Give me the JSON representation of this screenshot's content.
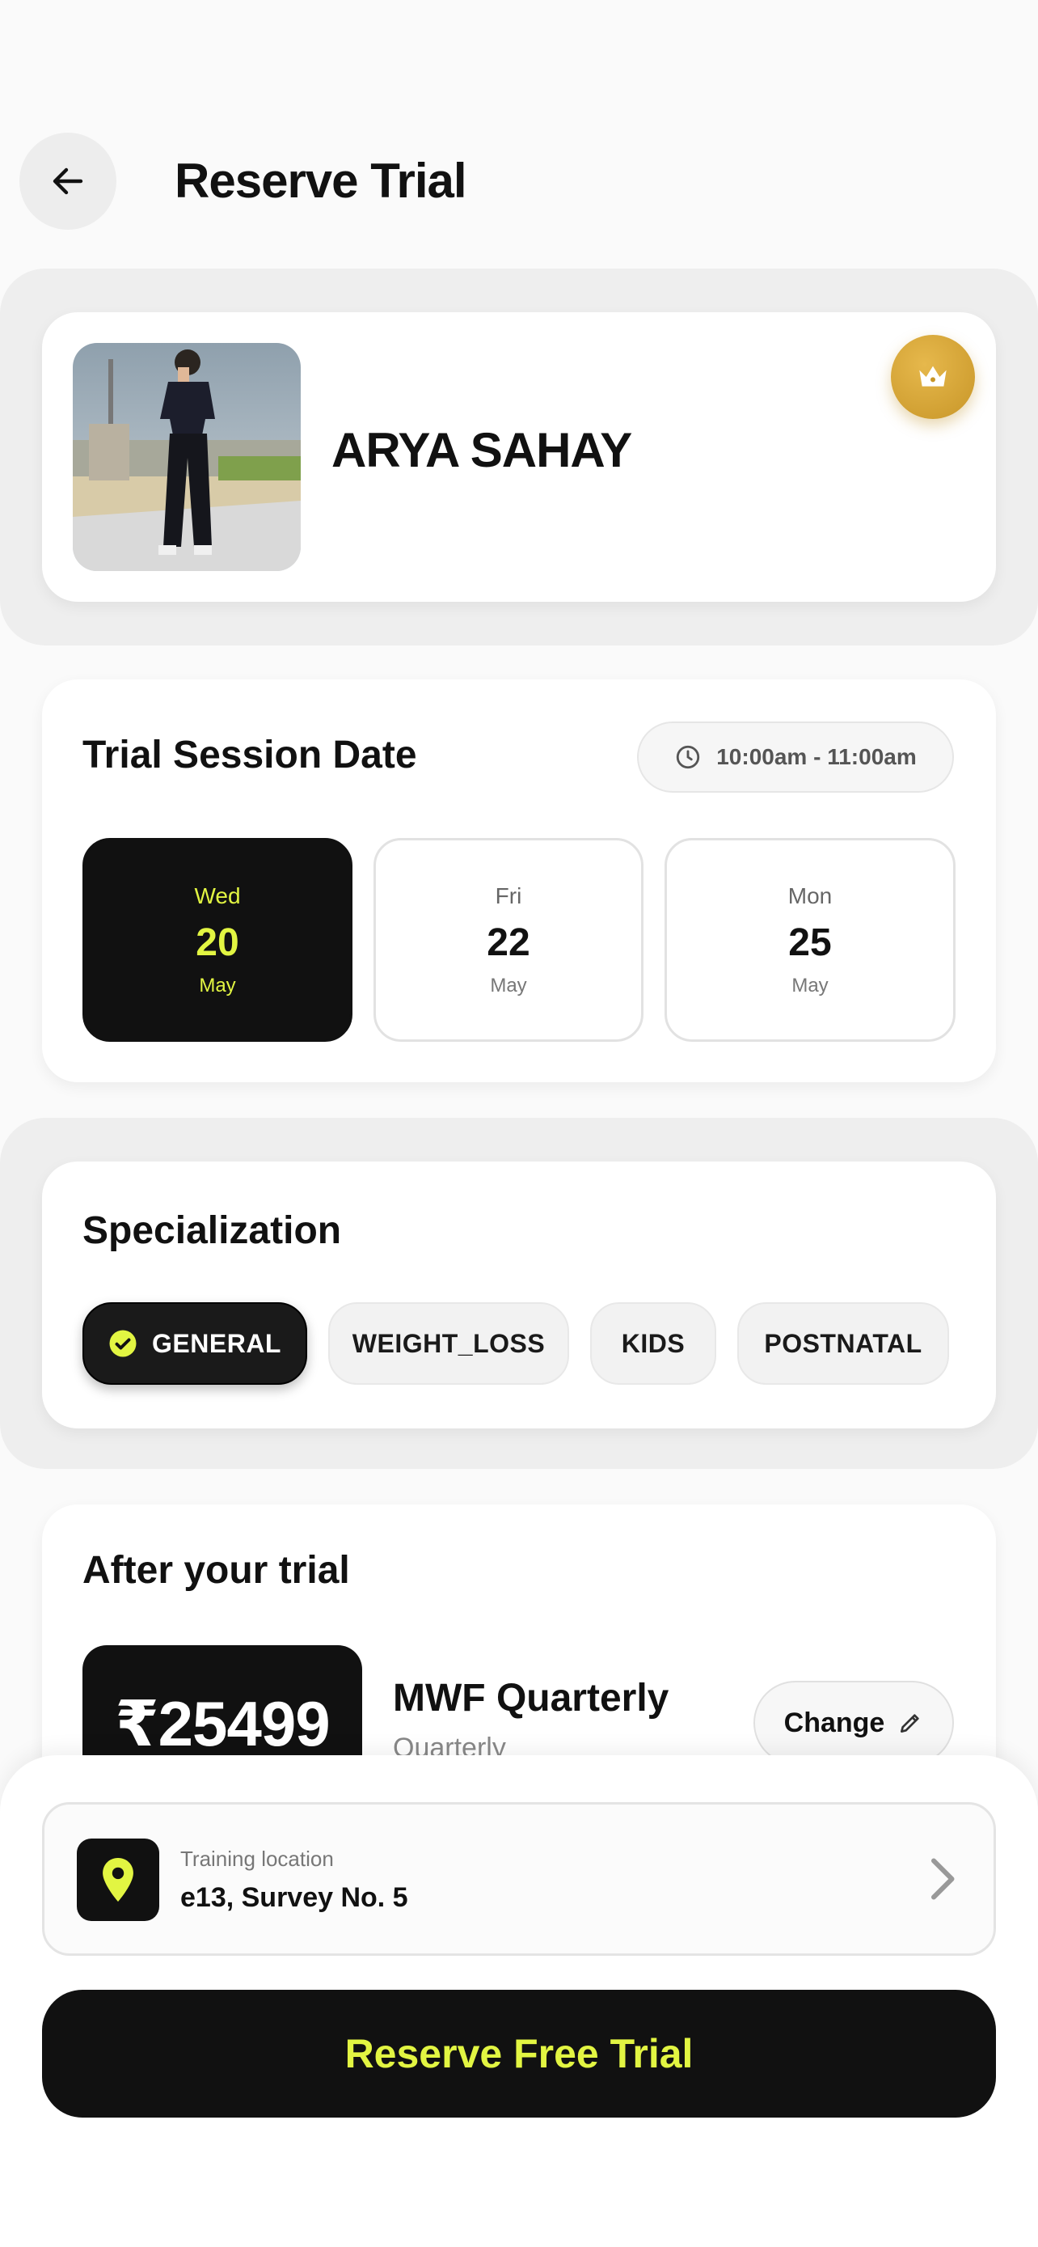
{
  "header": {
    "title": "Reserve Trial"
  },
  "trainer": {
    "name": "ARYA SAHAY"
  },
  "session": {
    "title": "Trial Session Date",
    "time": "10:00am - 11:00am",
    "dates": [
      {
        "day": "Wed",
        "num": "20",
        "month": "May",
        "selected": true
      },
      {
        "day": "Fri",
        "num": "22",
        "month": "May",
        "selected": false
      },
      {
        "day": "Mon",
        "num": "25",
        "month": "May",
        "selected": false
      }
    ]
  },
  "specialization": {
    "title": "Specialization",
    "chips": [
      "GENERAL",
      "WEIGHT_LOSS",
      "KIDS",
      "POSTNATAL"
    ],
    "selected": "GENERAL"
  },
  "after_trial": {
    "title": "After your trial",
    "price": "₹25499",
    "plan_name": "MWF Quarterly",
    "plan_sub": "Quarterly",
    "change_label": "Change"
  },
  "location": {
    "label": "Training location",
    "value": "e13, Survey No. 5"
  },
  "cta": {
    "label": "Reserve Free Trial"
  },
  "colors": {
    "accent": "#e2f542",
    "dark": "#111111",
    "gold": "#d4a63a"
  }
}
